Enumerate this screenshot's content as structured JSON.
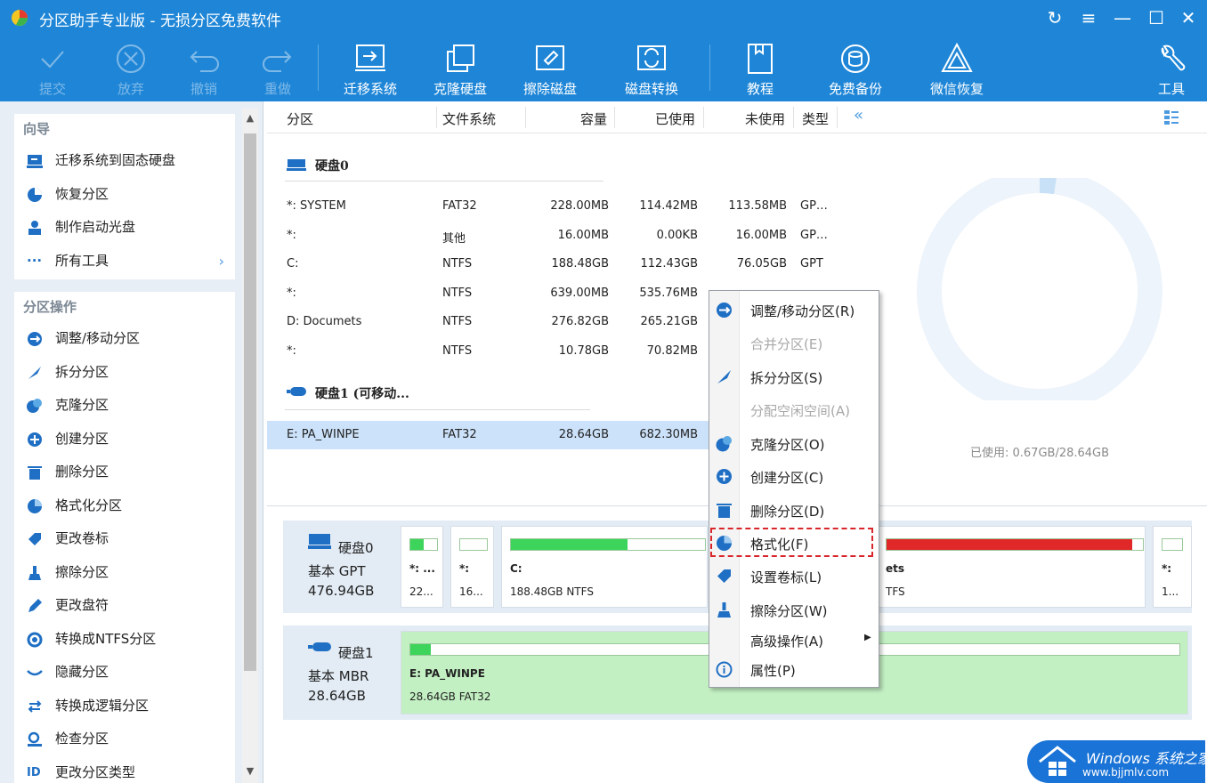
{
  "window": {
    "title": "分区助手专业版 - 无损分区免费软件",
    "controls": [
      "↻",
      "≡",
      "—",
      "☐",
      "✕"
    ]
  },
  "toolbar": {
    "commit": "提交",
    "discard": "放弃",
    "undo": "撤销",
    "redo": "重做",
    "migrate_os": "迁移系统",
    "clone_disk": "克隆硬盘",
    "wipe_disk": "擦除磁盘",
    "convert_disk": "磁盘转换",
    "tutorial": "教程",
    "free_backup": "免费备份",
    "wechat_recovery": "微信恢复",
    "tools": "工具"
  },
  "sidebar": {
    "wizard_title": "向导",
    "wizard_items": [
      {
        "label": "迁移系统到固态硬盘",
        "icon": "migrate-icon"
      },
      {
        "label": "恢复分区",
        "icon": "recover-icon"
      },
      {
        "label": "制作启动光盘",
        "icon": "bootdisk-icon"
      },
      {
        "label": "所有工具",
        "icon": "more-icon",
        "arrow": "›"
      }
    ],
    "ops_title": "分区操作",
    "ops_items": [
      {
        "label": "调整/移动分区",
        "icon": "resize-icon"
      },
      {
        "label": "拆分分区",
        "icon": "split-icon"
      },
      {
        "label": "克隆分区",
        "icon": "clone-icon"
      },
      {
        "label": "创建分区",
        "icon": "create-icon"
      },
      {
        "label": "删除分区",
        "icon": "delete-icon"
      },
      {
        "label": "格式化分区",
        "icon": "format-icon"
      },
      {
        "label": "更改卷标",
        "icon": "label-icon"
      },
      {
        "label": "擦除分区",
        "icon": "wipe-icon"
      },
      {
        "label": "更改盘符",
        "icon": "letter-icon"
      },
      {
        "label": "转换成NTFS分区",
        "icon": "convert-icon"
      },
      {
        "label": "隐藏分区",
        "icon": "hide-icon"
      },
      {
        "label": "转换成逻辑分区",
        "icon": "logical-icon"
      },
      {
        "label": "检查分区",
        "icon": "check-icon"
      },
      {
        "label": "更改分区类型",
        "icon": "type-icon"
      }
    ]
  },
  "table": {
    "headers": {
      "partition": "分区",
      "fs": "文件系统",
      "capacity": "容量",
      "used": "已使用",
      "unused": "未使用",
      "type": "类型",
      "collapse": "«"
    },
    "disk0_label": "硬盘0",
    "disk0_rows": [
      {
        "name": "*: SYSTEM",
        "fs": "FAT32",
        "cap": "228.00MB",
        "used": "114.42MB",
        "free": "113.58MB",
        "type": "GP…"
      },
      {
        "name": "*:",
        "fs": "其他",
        "cap": "16.00MB",
        "used": "0.00KB",
        "free": "16.00MB",
        "type": "GP…"
      },
      {
        "name": "C:",
        "fs": "NTFS",
        "cap": "188.48GB",
        "used": "112.43GB",
        "free": "76.05GB",
        "type": "GPT"
      },
      {
        "name": "*:",
        "fs": "NTFS",
        "cap": "639.00MB",
        "used": "535.76MB",
        "free": "",
        "type": ""
      },
      {
        "name": "D: Documets",
        "fs": "NTFS",
        "cap": "276.82GB",
        "used": "265.21GB",
        "free": "",
        "type": ""
      },
      {
        "name": "*:",
        "fs": "NTFS",
        "cap": "10.78GB",
        "used": "70.82MB",
        "free": "",
        "type": ""
      }
    ],
    "disk1_label": "硬盘1 (可移动...",
    "disk1_rows": [
      {
        "name": "E: PA_WINPE",
        "fs": "FAT32",
        "cap": "28.64GB",
        "used": "682.30MB",
        "free": "",
        "type": ""
      }
    ],
    "used_summary": "已使用: 0.67GB/28.64GB",
    "used_fraction": 0.0234
  },
  "diskmap": {
    "disk0": {
      "name": "硬盘0",
      "kind": "基本 GPT",
      "size": "476.94GB",
      "partitions": [
        {
          "label": "*: ...",
          "info": "22...",
          "fill": 0.5
        },
        {
          "label": "*:",
          "info": "16...",
          "fill": 0.0
        },
        {
          "label": "C:",
          "info": "188.48GB NTFS",
          "fill": 0.6
        },
        {
          "label": "ets",
          "info": "TFS",
          "fill": 0.96
        },
        {
          "label": "*:",
          "info": "1...",
          "fill": 0.0
        }
      ]
    },
    "disk1": {
      "name": "硬盘1",
      "kind": "基本 MBR",
      "size": "28.64GB",
      "partitions": [
        {
          "label": "E: PA_WINPE",
          "info": "28.64GB FAT32",
          "fill": 0.027
        }
      ]
    }
  },
  "context_menu": {
    "items": [
      {
        "label": "调整/移动分区(R)",
        "icon": "resize-icon",
        "disabled": false
      },
      {
        "label": "合并分区(E)",
        "icon": "",
        "disabled": true
      },
      {
        "label": "拆分分区(S)",
        "icon": "split-icon",
        "disabled": false
      },
      {
        "label": "分配空闲空间(A)",
        "icon": "",
        "disabled": true
      },
      {
        "label": "克隆分区(O)",
        "icon": "clone-icon",
        "disabled": false
      },
      {
        "label": "创建分区(C)",
        "icon": "create-icon",
        "disabled": false
      },
      {
        "label": "删除分区(D)",
        "icon": "delete-icon",
        "disabled": false
      },
      {
        "label": "格式化(F)",
        "icon": "format-icon",
        "disabled": false
      },
      {
        "label": "设置卷标(L)",
        "icon": "label-icon",
        "disabled": false
      },
      {
        "label": "擦除分区(W)",
        "icon": "wipe-icon",
        "disabled": false
      },
      {
        "label": "高级操作(A)",
        "icon": "",
        "disabled": false,
        "submenu": "▶"
      },
      {
        "label": "属性(P)",
        "icon": "info-icon",
        "disabled": false
      }
    ]
  },
  "watermark": {
    "line1": "Windows 系统之家",
    "line2": "www.bjjmlv.com"
  },
  "colors": {
    "accent": "#1f86d7",
    "used_bar": "#3cd45a",
    "full_bar": "#e02828",
    "highlight": "#d9262a"
  }
}
